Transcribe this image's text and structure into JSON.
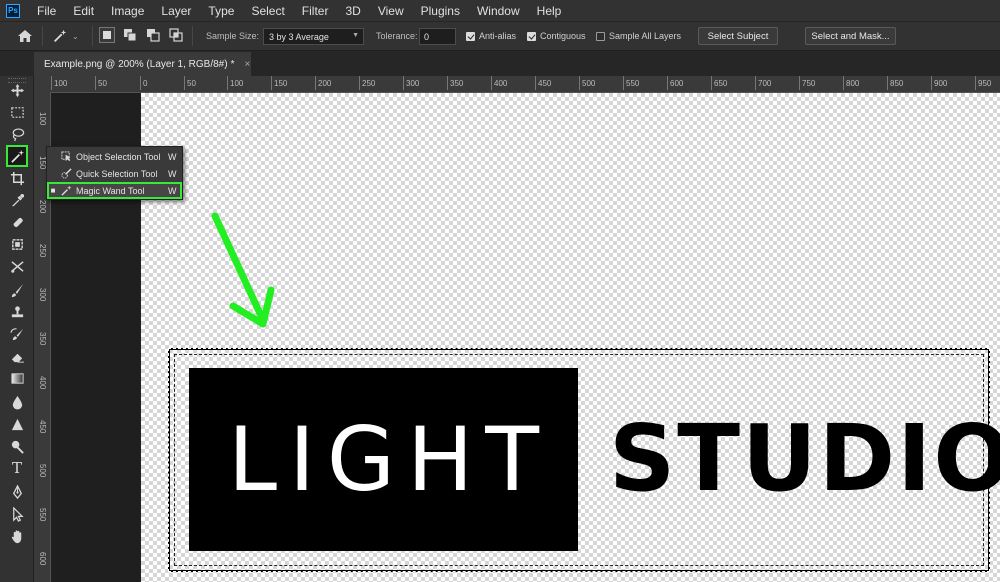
{
  "app": {
    "logo_text": "Ps"
  },
  "menu": [
    "File",
    "Edit",
    "Image",
    "Layer",
    "Type",
    "Select",
    "Filter",
    "3D",
    "View",
    "Plugins",
    "Window",
    "Help"
  ],
  "options_bar": {
    "sample_size_label": "Sample Size:",
    "sample_size_value": "3 by 3 Average",
    "tolerance_label": "Tolerance:",
    "tolerance_value": "0",
    "anti_alias_label": "Anti-alias",
    "anti_alias_checked": true,
    "contiguous_label": "Contiguous",
    "contiguous_checked": true,
    "sample_all_layers_label": "Sample All Layers",
    "sample_all_layers_checked": false,
    "select_subject_label": "Select Subject",
    "select_mask_label": "Select and Mask..."
  },
  "document_tab": {
    "title": "Example.png @ 200% (Layer 1, RGB/8#)",
    "modified_mark": "*",
    "close": "×"
  },
  "ruler_top": [
    "100",
    "50",
    "0",
    "50",
    "100",
    "150",
    "200",
    "250",
    "300",
    "350",
    "400",
    "450",
    "500",
    "550",
    "600",
    "650",
    "700",
    "750",
    "800",
    "850",
    "900",
    "950"
  ],
  "ruler_left": [
    "100",
    "150",
    "200",
    "250",
    "300",
    "350",
    "400",
    "450",
    "500",
    "550",
    "600"
  ],
  "tool_flyout": {
    "items": [
      {
        "label": "Object Selection Tool",
        "shortcut": "W",
        "selected": false
      },
      {
        "label": "Quick Selection Tool",
        "shortcut": "W",
        "selected": false
      },
      {
        "label": "Magic Wand Tool",
        "shortcut": "W",
        "selected": true
      }
    ]
  },
  "canvas": {
    "logo_left_text": "LIGHT",
    "logo_right_text": "STUDIO"
  },
  "colors": {
    "highlight": "#3ae83a",
    "arrow": "#22ee22"
  }
}
